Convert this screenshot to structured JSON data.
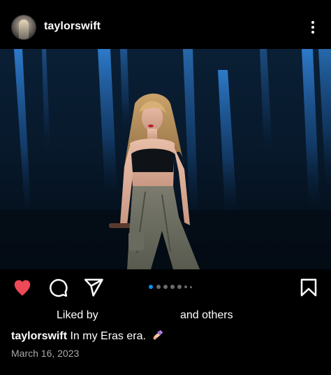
{
  "header": {
    "username": "taylorswift",
    "more_icon": "more-vertical-icon"
  },
  "post": {
    "image_description": "photo",
    "carousel": {
      "total": 7,
      "current": 1
    }
  },
  "actions": {
    "like_icon": "heart-filled-icon",
    "like_color": "#ed4956",
    "comment_icon": "comment-icon",
    "share_icon": "send-icon",
    "save_icon": "bookmark-icon"
  },
  "likes": {
    "prefix": "Liked by",
    "suffix": "and others"
  },
  "caption": {
    "username": "taylorswift",
    "text": "In my Eras era.",
    "emoji": "nail-polish-icon"
  },
  "date": "March 16, 2023"
}
